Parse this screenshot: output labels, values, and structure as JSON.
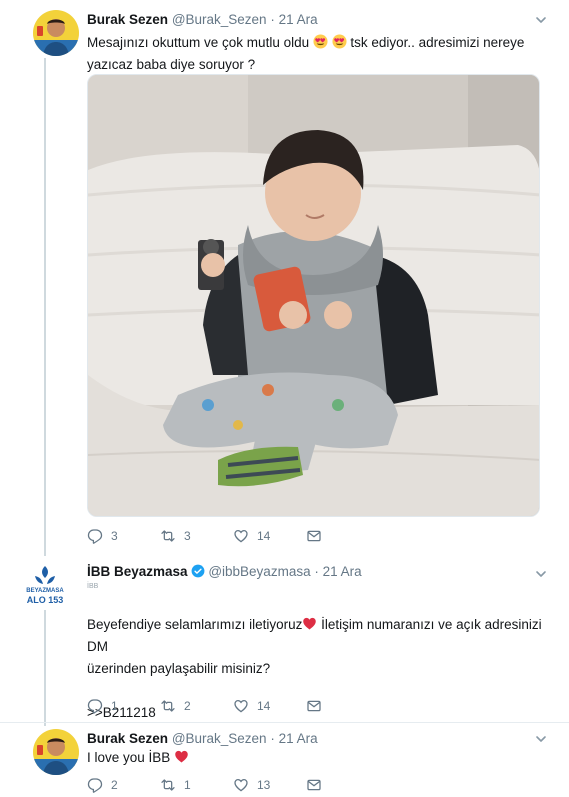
{
  "tweets": [
    {
      "author_name": "Burak Sezen",
      "handle": "@Burak_Sezen",
      "separator": "·",
      "time": "21 Ara",
      "text_parts": [
        "Mesajınızı okuttum ve çok mutlu oldu ",
        " tsk ediyor.. adresimizi nereye yazıcaz baba diye soruyor ?"
      ],
      "emojis": [
        "heart-eyes-emoji",
        "heart-eyes-emoji"
      ],
      "actions": {
        "reply": "3",
        "retweet": "3",
        "like": "14"
      }
    },
    {
      "author_name": "İBB Beyazmasa",
      "verified": true,
      "handle": "@ibbBeyazmasa",
      "separator": "·",
      "time": "21 Ara",
      "avatar_text": [
        "BEYAZMASA",
        "ALO 153"
      ],
      "sub_caption": "İBB",
      "text_line1_a": "Beyefendiye selamlarımızı iletiyoruz",
      "text_line1_b": " İletişim numaranızı ve açık adresinizi DM",
      "text_line2": "üzerinden paylaşabilir misiniz?",
      "reference": ">>B211218",
      "actions": {
        "reply": "1",
        "retweet": "2",
        "like": "14"
      }
    },
    {
      "author_name": "Burak Sezen",
      "handle": "@Burak_Sezen",
      "separator": "·",
      "time": "21 Ara",
      "text": "I love you İBB",
      "actions": {
        "reply": "2",
        "retweet": "1",
        "like": "13"
      }
    }
  ],
  "colors": {
    "text": "#14171a",
    "muted": "#657786",
    "verified": "#1da1f2",
    "heart": "#e0245e",
    "thread_line": "#cfd9de",
    "divider": "#e6ecf0"
  }
}
